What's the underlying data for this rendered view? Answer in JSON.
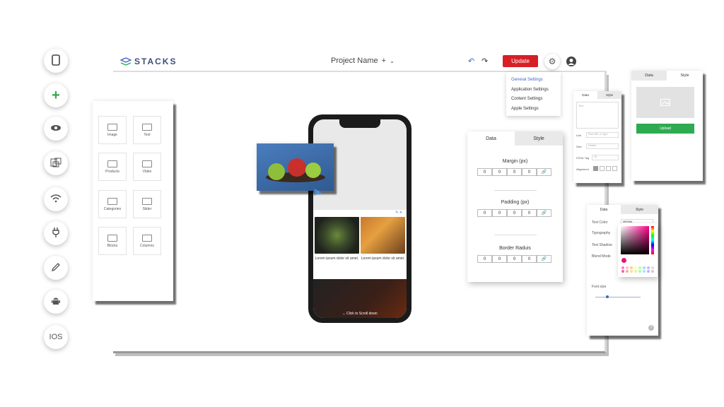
{
  "rail": [
    {
      "name": "phone-icon",
      "glyph": "▯"
    },
    {
      "name": "plus-icon",
      "glyph": "+"
    },
    {
      "name": "eye-icon",
      "glyph": "◉"
    },
    {
      "name": "devices-icon",
      "glyph": "▦"
    },
    {
      "name": "wifi-icon",
      "glyph": "≋"
    },
    {
      "name": "plug-icon",
      "glyph": "⏚"
    },
    {
      "name": "pencil-icon",
      "glyph": "✎"
    },
    {
      "name": "android-icon",
      "glyph": "♟"
    },
    {
      "name": "ios-label",
      "glyph": "IOS"
    }
  ],
  "header": {
    "logo": "STACKS",
    "project_name": "Project Name",
    "project_plus": "+",
    "update_label": "Update"
  },
  "settings_menu": [
    "General Settings",
    "Application Settings",
    "Content Settings",
    "Apple Settings"
  ],
  "widgets": [
    "Image",
    "Text",
    "Products",
    "Video",
    "Categories",
    "Slider",
    "Blocks",
    "Columns"
  ],
  "phone": {
    "card1": "Lorem ipsum dolor sit amet.",
    "card2": "Lorem ipsum dolor sit amet.",
    "scroll_hint": "Click to Scroll down"
  },
  "style_panel": {
    "tab_data": "Data",
    "tab_style": "Style",
    "margin_title": "Margin (px)",
    "padding_title": "Padding (px)",
    "border_title": "Border Raduis",
    "values": [
      "0",
      "0",
      "0",
      "0"
    ]
  },
  "link_panel": {
    "tab_data": "Data",
    "tab_style": "Style",
    "text_placeholder": "Text",
    "link_label": "Link",
    "link_placeholder": "Past URL or Type",
    "size_label": "Size",
    "size_value": "Default",
    "html_tag_label": "HTML Tag",
    "html_tag_value": "H2",
    "alignment_label": "Alignment"
  },
  "upload_panel": {
    "tab_data": "Data",
    "tab_style": "Style",
    "upload_label": "Upload"
  },
  "color_panel": {
    "tab_data": "Data",
    "tab_style": "Style",
    "text_color_label": "Text Color",
    "text_color_value": "#ff008a",
    "typography_label": "Typography",
    "text_shadow_label": "Text Shadow",
    "blend_mode_label": "Blend Mode",
    "font_size_label": "Font size"
  },
  "colors": {
    "accent": "#d81f26",
    "link": "#3b66c9",
    "upload": "#2eaa50",
    "add": "#2eaa50"
  }
}
